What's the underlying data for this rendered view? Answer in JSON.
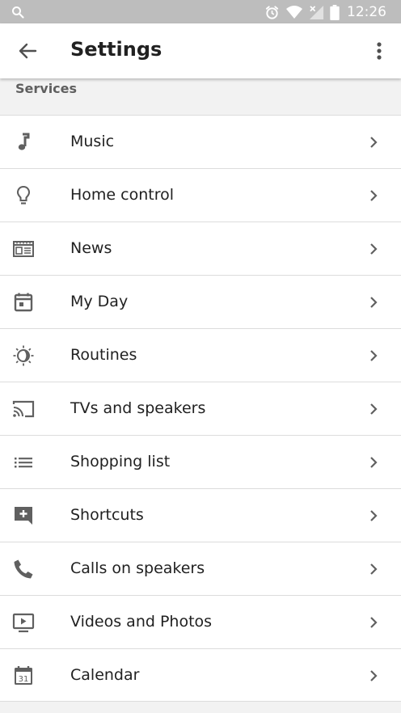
{
  "status_bar": {
    "time": "12:26"
  },
  "app_bar": {
    "title": "Settings"
  },
  "section": {
    "title": "Services"
  },
  "items": [
    {
      "label": "Music",
      "icon": "music-note-icon"
    },
    {
      "label": "Home control",
      "icon": "lightbulb-icon"
    },
    {
      "label": "News",
      "icon": "newspaper-icon"
    },
    {
      "label": "My Day",
      "icon": "calendar-today-icon"
    },
    {
      "label": "Routines",
      "icon": "routines-sun-icon"
    },
    {
      "label": "TVs and speakers",
      "icon": "cast-icon"
    },
    {
      "label": "Shopping list",
      "icon": "list-icon"
    },
    {
      "label": "Shortcuts",
      "icon": "add-comment-icon"
    },
    {
      "label": "Calls on speakers",
      "icon": "phone-icon"
    },
    {
      "label": "Videos and Photos",
      "icon": "video-play-icon"
    },
    {
      "label": "Calendar",
      "icon": "calendar-31-icon",
      "badge": "31"
    }
  ],
  "colors": {
    "status_bar": "#bdbdbd",
    "app_bar": "#ffffff",
    "background": "#f2f2f2",
    "icon": "#606060",
    "text": "#212121"
  }
}
